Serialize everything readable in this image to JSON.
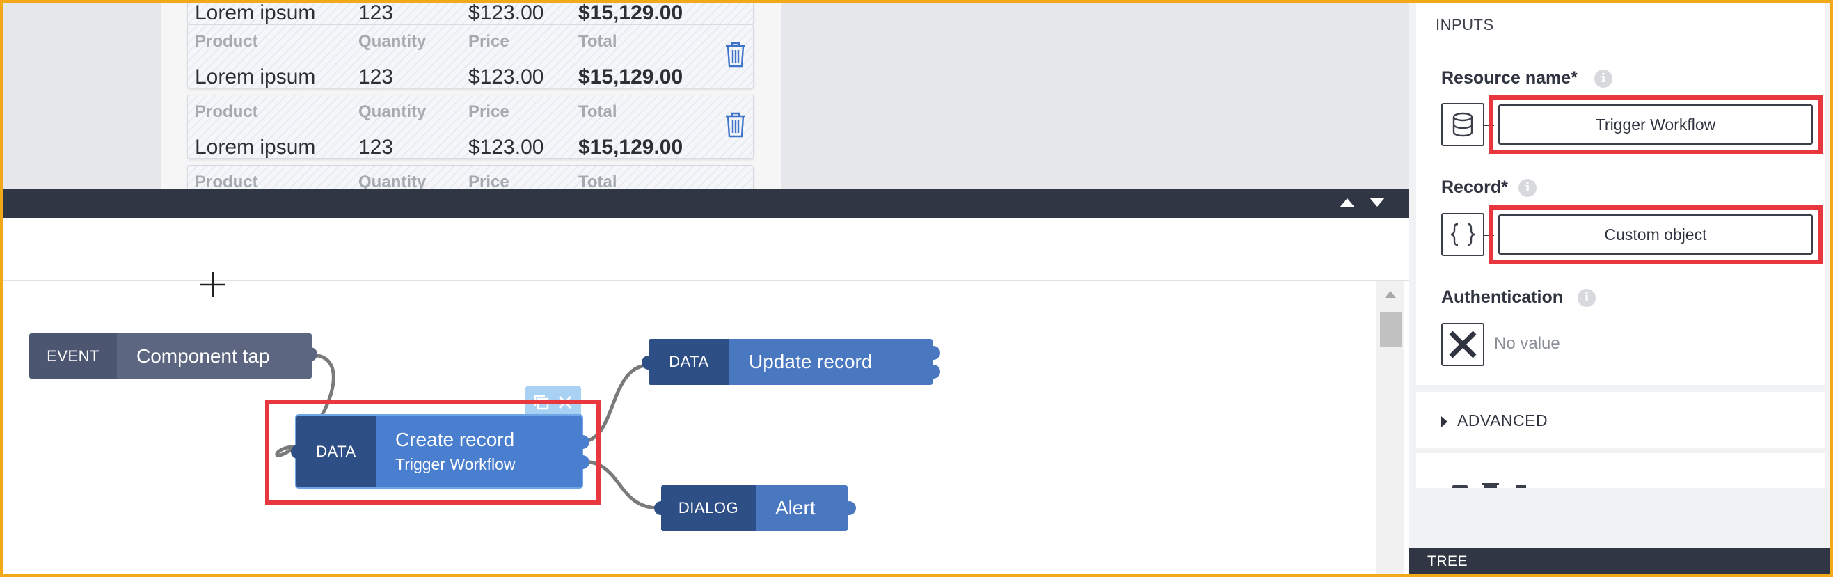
{
  "preview": {
    "rows": [
      {
        "product_label": "",
        "quantity_label": "",
        "price_label": "",
        "total_label": "",
        "product": "Lorem ipsum",
        "quantity": "123",
        "price": "$123.00",
        "total": "$15,129.00"
      },
      {
        "product_label": "Product",
        "quantity_label": "Quantity",
        "price_label": "Price",
        "total_label": "Total",
        "product": "Lorem ipsum",
        "quantity": "123",
        "price": "$123.00",
        "total": "$15,129.00"
      },
      {
        "product_label": "Product",
        "quantity_label": "Quantity",
        "price_label": "Price",
        "total_label": "Total",
        "product": "Lorem ipsum",
        "quantity": "123",
        "price": "$123.00",
        "total": "$15,129.00"
      },
      {
        "product_label": "Product",
        "quantity_label": "Quantity",
        "price_label": "Price",
        "total_label": "Total",
        "product": "",
        "quantity": "",
        "price": "",
        "total": ""
      }
    ],
    "icons": {
      "delete": "trash-icon"
    }
  },
  "splitter": {
    "up_icon": "caret-up-icon",
    "down_icon": "caret-down-icon"
  },
  "workflow": {
    "nodes": {
      "event": {
        "type": "EVENT",
        "label": "Component tap"
      },
      "create": {
        "type": "DATA",
        "label": "Create record",
        "sublabel": "Trigger Workflow"
      },
      "update": {
        "type": "DATA",
        "label": "Update record"
      },
      "alert": {
        "type": "DIALOG",
        "label": "Alert"
      }
    },
    "node_actions": {
      "copy_icon": "copy-icon",
      "delete_icon": "close-icon"
    },
    "colors": {
      "event_type": "#4d5670",
      "event_label": "#5c6680",
      "data_type": "#2e4f86",
      "data_label": "#4a78c0",
      "selected_label": "#4a7fcf",
      "highlight": "#e8373f",
      "wire": "#7a7a7a"
    }
  },
  "inspector": {
    "section_title": "INPUTS",
    "resource_name": {
      "label": "Resource name*",
      "value": "Trigger Workflow",
      "icon": "database-icon"
    },
    "record": {
      "label": "Record*",
      "value": "Custom object",
      "icon": "braces-icon"
    },
    "authentication": {
      "label": "Authentication",
      "value": "No value",
      "icon": "x-icon"
    },
    "advanced": {
      "label": "ADVANCED"
    },
    "tree": {
      "label": "TREE"
    }
  }
}
